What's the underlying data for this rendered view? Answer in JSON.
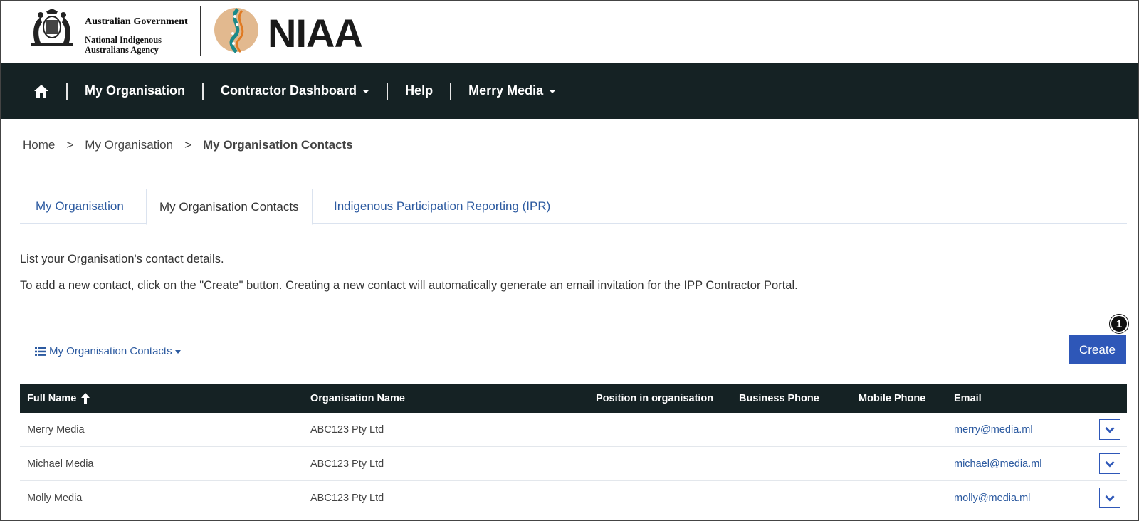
{
  "header": {
    "gov_line1": "Australian Government",
    "gov_line2": "National Indigenous",
    "gov_line3": "Australians Agency",
    "agency_acronym": "NIAA",
    "crest_icon": "coat-of-arms-icon",
    "emblem_icon": "niaa-emblem-icon"
  },
  "nav": {
    "home_icon": "home-icon",
    "items": [
      {
        "label": "My Organisation",
        "dropdown": false
      },
      {
        "label": "Contractor Dashboard",
        "dropdown": true
      },
      {
        "label": "Help",
        "dropdown": false
      },
      {
        "label": "Merry Media",
        "dropdown": true
      }
    ]
  },
  "breadcrumb": {
    "items": [
      "Home",
      "My Organisation"
    ],
    "separator": ">",
    "current": "My Organisation Contacts"
  },
  "tabs": [
    {
      "label": "My Organisation",
      "active": false
    },
    {
      "label": "My Organisation Contacts",
      "active": true
    },
    {
      "label": "Indigenous Participation Reporting (IPR)",
      "active": false
    }
  ],
  "description": {
    "line1": "List your Organisation's contact details.",
    "line2": "To add a new contact, click on the \"Create\" button. Creating a new contact will automatically generate an email invitation for the IPP Contractor Portal."
  },
  "view_selector": {
    "label": "My Organisation Contacts",
    "icon": "list-icon"
  },
  "create_button": {
    "label": "Create",
    "step_badge": "1"
  },
  "table": {
    "columns": [
      "Full Name",
      "Organisation Name",
      "Position in organisation",
      "Business Phone",
      "Mobile Phone",
      "Email"
    ],
    "sort_column": "Full Name",
    "sort_icon": "arrow-up-icon",
    "rows": [
      {
        "full_name": "Merry Media",
        "organisation": "ABC123 Pty Ltd",
        "position": "",
        "business_phone": "",
        "mobile_phone": "",
        "email": "merry@media.ml"
      },
      {
        "full_name": "Michael Media",
        "organisation": "ABC123 Pty Ltd",
        "position": "",
        "business_phone": "",
        "mobile_phone": "",
        "email": "michael@media.ml"
      },
      {
        "full_name": "Molly Media",
        "organisation": "ABC123 Pty Ltd",
        "position": "",
        "business_phone": "",
        "mobile_phone": "",
        "email": "molly@media.ml"
      }
    ],
    "row_action_icon": "chevron-down-icon"
  },
  "colors": {
    "nav_bg": "#152224",
    "accent": "#2e57b8",
    "link": "#2c5aa0"
  }
}
